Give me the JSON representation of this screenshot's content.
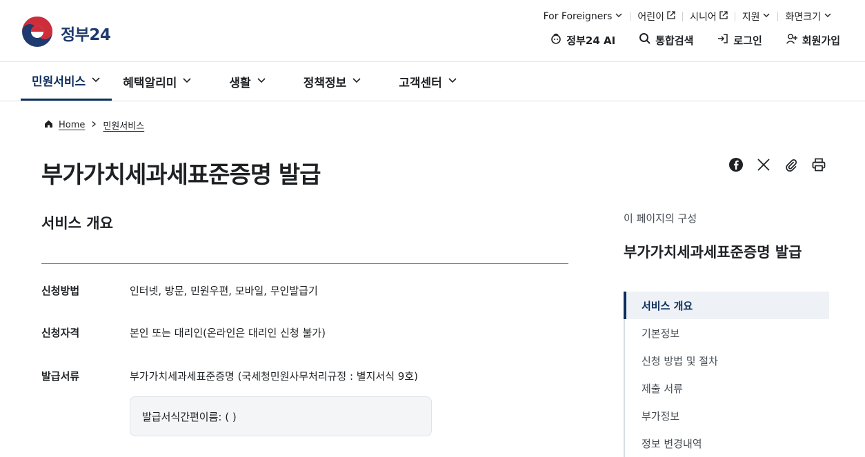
{
  "header": {
    "logo_text": "정부24",
    "utility": [
      {
        "label": "For Foreigners",
        "icon": "chevron-down-icon"
      },
      {
        "label": "어린이",
        "icon": "external-link-icon"
      },
      {
        "label": "시니어",
        "icon": "external-link-icon"
      },
      {
        "label": "지원",
        "icon": "chevron-down-icon"
      },
      {
        "label": "화면크기",
        "icon": "chevron-down-icon"
      }
    ],
    "actions": [
      {
        "label": "정부24 AI",
        "icon": "ai-icon"
      },
      {
        "label": "통합검색",
        "icon": "search-icon"
      },
      {
        "label": "로그인",
        "icon": "login-icon"
      },
      {
        "label": "회원가입",
        "icon": "user-plus-icon"
      }
    ]
  },
  "gnb": [
    {
      "label": "민원서비스",
      "active": true
    },
    {
      "label": "혜택알리미"
    },
    {
      "label": "생활"
    },
    {
      "label": "정책정보"
    },
    {
      "label": "고객센터"
    }
  ],
  "breadcrumb": {
    "home": "Home",
    "current": "민원서비스"
  },
  "page_title": "부가가치세과세표준증명 발급",
  "share_icons": [
    "facebook-icon",
    "x-icon",
    "link-icon",
    "print-icon"
  ],
  "overview": {
    "heading": "서비스 개요",
    "rows": [
      {
        "label": "신청방법",
        "value": "인터넷, 방문, 민원우편, 모바일, 무인발급기"
      },
      {
        "label": "신청자격",
        "value": "본인 또는 대리인(온라인은 대리인 신청 불가)"
      },
      {
        "label": "발급서류",
        "value": "부가가치세과세표준증명 (국세청민원사무처리규정 : 별지서식 9호)"
      }
    ],
    "form_note": "발급서식간편이름: ( )"
  },
  "toc": {
    "caption": "이 페이지의 구성",
    "title": "부가가치세과세표준증명 발급",
    "items": [
      "서비스 개요",
      "기본정보",
      "신청 방법 및 절차",
      "제출 서류",
      "부가정보",
      "정보 변경내역"
    ]
  },
  "colors": {
    "brand": "#0b2e5e",
    "text": "#1e2124",
    "muted": "#464c53"
  }
}
